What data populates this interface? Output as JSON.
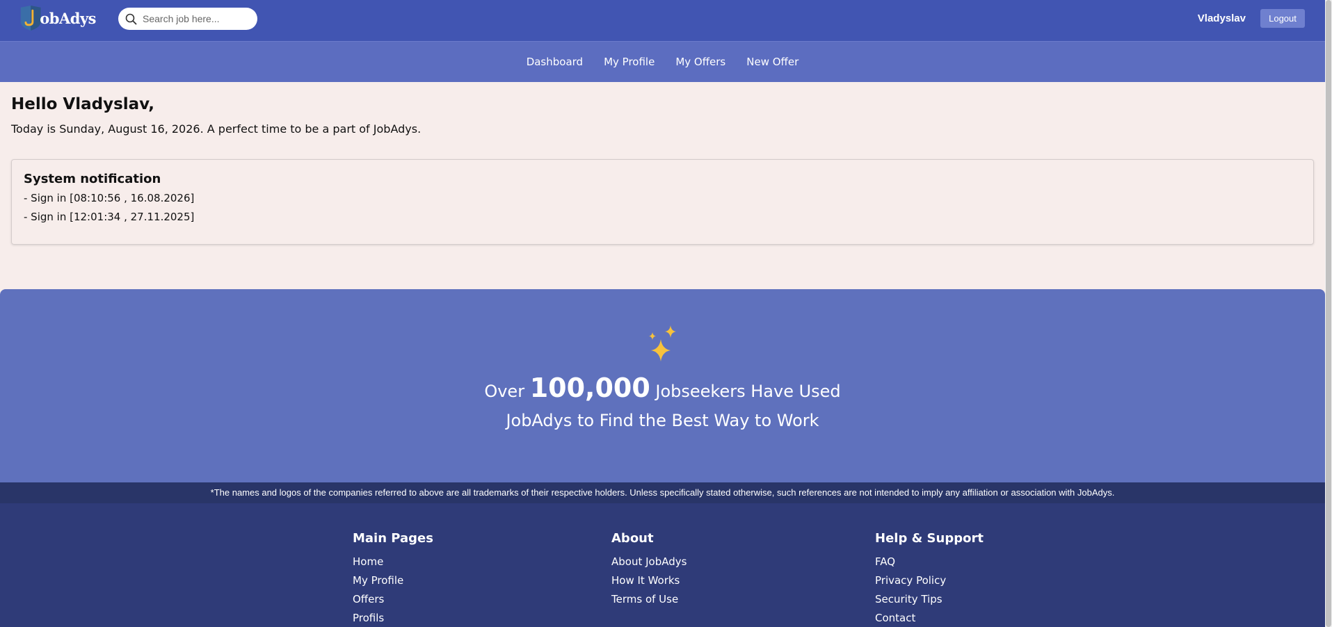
{
  "header": {
    "logo_text": "obAdys",
    "search_placeholder": "Search job here...",
    "username": "Vladyslav",
    "logout_label": "Logout"
  },
  "nav": {
    "items": [
      {
        "label": "Dashboard"
      },
      {
        "label": "My Profile"
      },
      {
        "label": "My Offers"
      },
      {
        "label": "New Offer"
      }
    ]
  },
  "main": {
    "greeting": "Hello Vladyslav,",
    "today": "Today is Sunday, August 16, 2026. A perfect time to be a part of JobAdys.",
    "notification": {
      "title": "System notification",
      "entries": [
        "- Sign in [08:10:56 , 16.08.2026]",
        "- Sign in [12:01:34 , 27.11.2025]"
      ]
    }
  },
  "hero": {
    "prefix": "Over ",
    "number": "100,000",
    "suffix": " Jobseekers Have Used",
    "line2": "JobAdys to Find the Best Way to Work",
    "icon": "sparkles-icon"
  },
  "disclaimer": "*The names and logos of the companies referred to above are all trademarks of their respective holders. Unless specifically stated otherwise, such references are not intended to imply any affiliation or association with JobAdys.",
  "footer": {
    "columns": [
      {
        "title": "Main Pages",
        "links": [
          "Home",
          "My Profile",
          "Offers",
          "Profils"
        ]
      },
      {
        "title": "About",
        "links": [
          "About JobAdys",
          "How It Works",
          "Terms of Use"
        ]
      },
      {
        "title": "Help & Support",
        "links": [
          "FAQ",
          "Privacy Policy",
          "Security Tips",
          "Contact"
        ]
      }
    ]
  },
  "colors": {
    "topbar": "#4155b2",
    "navbar": "#5c6dc0",
    "page_bg": "#f7edeb",
    "hero": "#5f71bd",
    "footer": "#2f3b78",
    "sparkle": "#f7c23c"
  }
}
